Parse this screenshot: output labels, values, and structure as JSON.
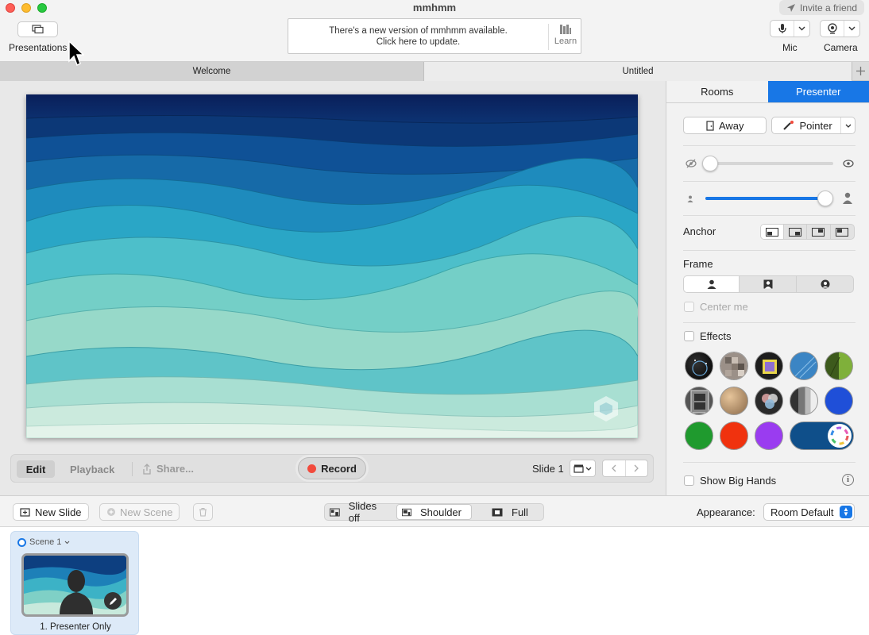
{
  "window": {
    "title": "mmhmm",
    "invite_label": "Invite a friend"
  },
  "toolbar": {
    "presentations_label": "Presentations",
    "update_line1": "There's a new version of mmhmm available.",
    "update_line2": "Click here to update.",
    "learn_label": "Learn",
    "mic_label": "Mic",
    "camera_label": "Camera"
  },
  "tabs": [
    {
      "label": "Welcome"
    },
    {
      "label": "Untitled"
    }
  ],
  "controls": {
    "edit": "Edit",
    "playback": "Playback",
    "share": "Share...",
    "record": "Record",
    "slide": "Slide 1"
  },
  "panel": {
    "tabs": [
      {
        "label": "Rooms"
      },
      {
        "label": "Presenter"
      }
    ],
    "active_tab": "Presenter",
    "away_label": "Away",
    "pointer_label": "Pointer",
    "opacity_level": 0.04,
    "size_level": 0.94,
    "anchor_label": "Anchor",
    "frame_label": "Frame",
    "center_me_label": "Center me",
    "effects_label": "Effects",
    "show_big_hands_label": "Show Big Hands"
  },
  "bottom": {
    "new_slide": "New Slide",
    "new_scene": "New Scene",
    "view_modes": [
      {
        "label": "Slides off"
      },
      {
        "label": "Shoulder"
      },
      {
        "label": "Full"
      }
    ],
    "active_view": "Shoulder",
    "appearance_label": "Appearance:",
    "appearance_value": "Room Default"
  },
  "scene": {
    "name": "Scene 1",
    "slide_label": "1. Presenter Only"
  },
  "colors": {
    "accent": "#1877e6",
    "record_dot": "#f24a3c"
  }
}
